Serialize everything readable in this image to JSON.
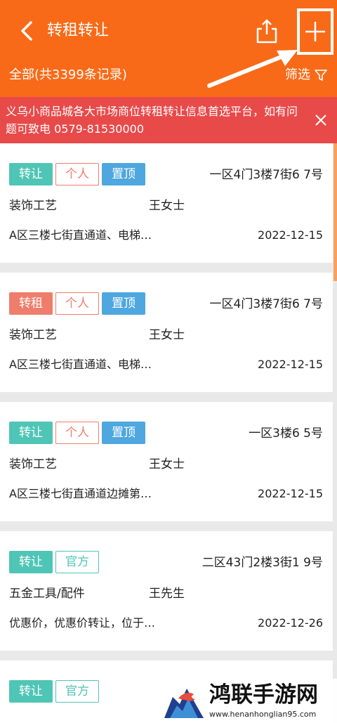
{
  "header": {
    "title": "转租转让",
    "total_label": "全部(共3399条记录)",
    "filter_label": "筛选"
  },
  "notice": {
    "text": "义乌小商品城各大市场商位转租转让信息首选平台，如有问题可致电 0579-81530000"
  },
  "listings": [
    {
      "type_tag": "转让",
      "source_tag": "个人",
      "top_tag": "置顶",
      "location": "一区4门3楼7街6 7号",
      "category": "装饰工艺",
      "contact": "王女士",
      "description": "A区三楼七街直通道、电梯…",
      "date": "2022-12-15"
    },
    {
      "type_tag": "转租",
      "source_tag": "个人",
      "top_tag": "置顶",
      "location": "一区4门3楼7街6 7号",
      "category": "装饰工艺",
      "contact": "王女士",
      "description": "A区三楼七街直通道、电梯…",
      "date": "2022-12-15"
    },
    {
      "type_tag": "转让",
      "source_tag": "个人",
      "top_tag": "置顶",
      "location": "一区3楼6 5号",
      "category": "装饰工艺",
      "contact": "王女士",
      "description": "A区三楼七街直通道边摊第…",
      "date": "2022-12-15"
    },
    {
      "type_tag": "转让",
      "source_tag": "官方",
      "location": "二区43门2楼3街1 9号",
      "category": "五金工具/配件",
      "contact": "王先生",
      "description": "优惠价，优惠价转让，位于…",
      "date": "2022-12-26"
    },
    {
      "type_tag": "转让",
      "source_tag": "官方"
    }
  ],
  "watermark": {
    "name": "鸿联手游网",
    "url": "www.henanhonglian95.com"
  },
  "colors": {
    "header_bg": "#f96a18",
    "notice_bg": "#e84a4a",
    "tag_transfer": "#4fc5b6",
    "tag_rent": "#ef7d6b",
    "tag_top": "#4ea7df"
  }
}
